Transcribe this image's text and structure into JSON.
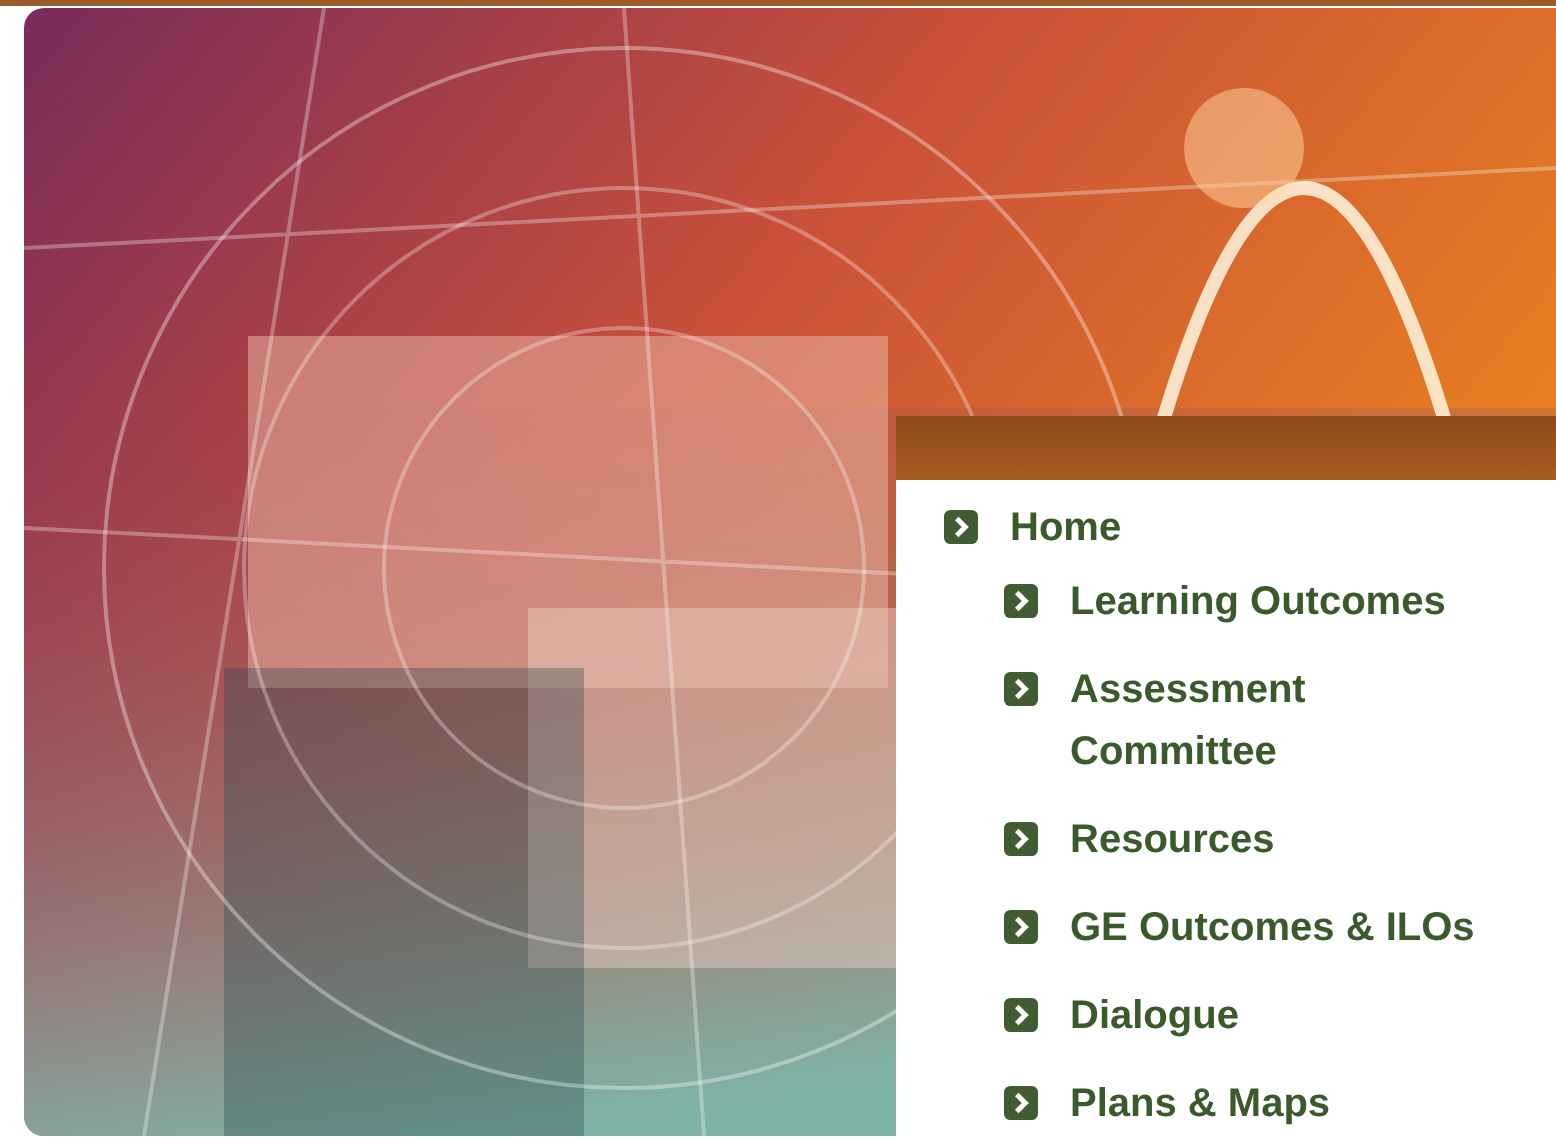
{
  "nav": {
    "items": [
      {
        "label": "Home",
        "children": [
          {
            "label": "Learning Outcomes"
          },
          {
            "label": "Assessment Committee"
          },
          {
            "label": "Resources"
          },
          {
            "label": "GE Outcomes & ILOs"
          },
          {
            "label": "Dialogue"
          },
          {
            "label": "Plans & Maps"
          }
        ]
      }
    ]
  }
}
